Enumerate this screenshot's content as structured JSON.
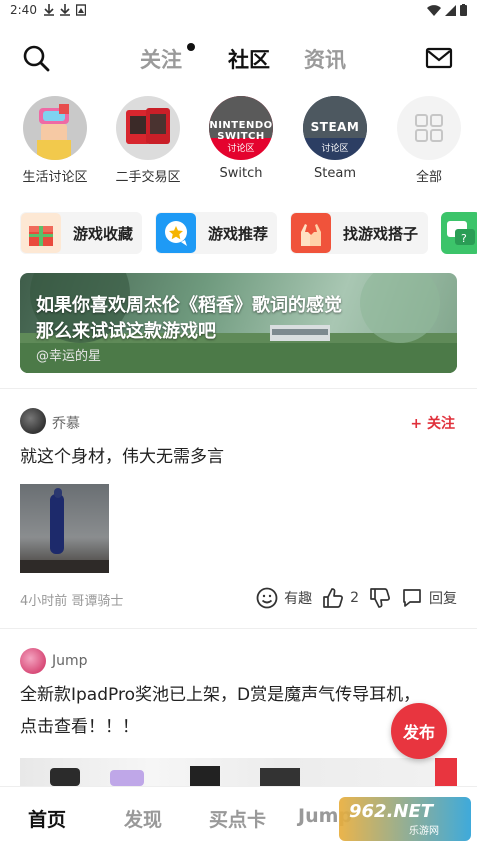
{
  "status": {
    "time": "2:40"
  },
  "topbar": {
    "tabs": [
      {
        "label": "关注"
      },
      {
        "label": "社区"
      },
      {
        "label": "资讯"
      }
    ]
  },
  "circles": [
    {
      "label": "生活讨论区"
    },
    {
      "label": "二手交易区"
    },
    {
      "label": "Switch",
      "badge": "讨论区",
      "logo": "NINTENDO SWITCH"
    },
    {
      "label": "Steam",
      "badge": "讨论区",
      "logo": "STEAM"
    },
    {
      "label": "全部"
    }
  ],
  "chips": [
    {
      "label": "游戏收藏"
    },
    {
      "label": "游戏推荐"
    },
    {
      "label": "找游戏搭子"
    }
  ],
  "banner": {
    "line1": "如果你喜欢周杰伦《稻香》歌词的感觉",
    "line2": "那么来试试这款游戏吧",
    "author": "@幸运的星"
  },
  "posts": [
    {
      "user": "乔慕",
      "follow": "+ 关注",
      "text": "就这个身材，伟大无需多言",
      "meta": "4小时前 哥谭骑士",
      "react_label": "有趣",
      "likes": "2",
      "reply_label": "回复"
    },
    {
      "user": "Jump",
      "text_line1": "全新款IpadPro奖池已上架，D赏是魔声气传导耳机，",
      "text_line2": "点击查看！！！"
    }
  ],
  "fab": {
    "label": "发布"
  },
  "bottomnav": [
    {
      "label": "首页"
    },
    {
      "label": "发现"
    },
    {
      "label": "买点卡"
    },
    {
      "label": "Jump"
    }
  ],
  "watermark": {
    "brand": "962.NET",
    "sub": "乐游网"
  },
  "colors": {
    "accent": "#e8353f",
    "follow": "#e0303b"
  }
}
